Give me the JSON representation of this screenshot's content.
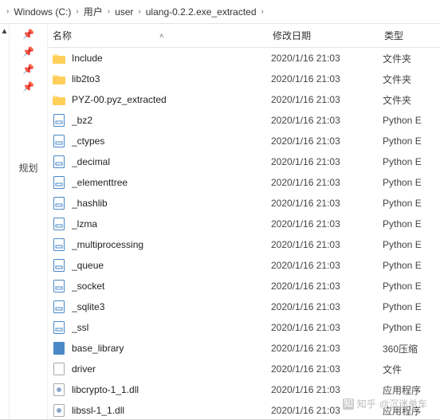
{
  "breadcrumb": {
    "items": [
      {
        "label": "Windows (C:)"
      },
      {
        "label": "用户"
      },
      {
        "label": "user"
      },
      {
        "label": "ulang-0.2.2.exe_extracted"
      }
    ],
    "separator": "›"
  },
  "sidebar": {
    "label": "规划"
  },
  "columns": {
    "name": "名称",
    "date": "修改日期",
    "type": "类型"
  },
  "watermark": {
    "prefix": "知乎",
    "text": "@沉迷单车"
  },
  "files": [
    {
      "icon": "folder",
      "name": "Include",
      "date": "2020/1/16 21:03",
      "type": "文件夹"
    },
    {
      "icon": "folder",
      "name": "lib2to3",
      "date": "2020/1/16 21:03",
      "type": "文件夹"
    },
    {
      "icon": "folder",
      "name": "PYZ-00.pyz_extracted",
      "date": "2020/1/16 21:03",
      "type": "文件夹"
    },
    {
      "icon": "py",
      "name": "_bz2",
      "date": "2020/1/16 21:03",
      "type": "Python E"
    },
    {
      "icon": "py",
      "name": "_ctypes",
      "date": "2020/1/16 21:03",
      "type": "Python E"
    },
    {
      "icon": "py",
      "name": "_decimal",
      "date": "2020/1/16 21:03",
      "type": "Python E"
    },
    {
      "icon": "py",
      "name": "_elementtree",
      "date": "2020/1/16 21:03",
      "type": "Python E"
    },
    {
      "icon": "py",
      "name": "_hashlib",
      "date": "2020/1/16 21:03",
      "type": "Python E"
    },
    {
      "icon": "py",
      "name": "_lzma",
      "date": "2020/1/16 21:03",
      "type": "Python E"
    },
    {
      "icon": "py",
      "name": "_multiprocessing",
      "date": "2020/1/16 21:03",
      "type": "Python E"
    },
    {
      "icon": "py",
      "name": "_queue",
      "date": "2020/1/16 21:03",
      "type": "Python E"
    },
    {
      "icon": "py",
      "name": "_socket",
      "date": "2020/1/16 21:03",
      "type": "Python E"
    },
    {
      "icon": "py",
      "name": "_sqlite3",
      "date": "2020/1/16 21:03",
      "type": "Python E"
    },
    {
      "icon": "py",
      "name": "_ssl",
      "date": "2020/1/16 21:03",
      "type": "Python E"
    },
    {
      "icon": "zip",
      "name": "base_library",
      "date": "2020/1/16 21:03",
      "type": "360压缩"
    },
    {
      "icon": "file",
      "name": "driver",
      "date": "2020/1/16 21:03",
      "type": "文件"
    },
    {
      "icon": "dll",
      "name": "libcrypto-1_1.dll",
      "date": "2020/1/16 21:03",
      "type": "应用程序"
    },
    {
      "icon": "dll",
      "name": "libssl-1_1.dll",
      "date": "2020/1/16 21:03",
      "type": "应用程序"
    }
  ]
}
